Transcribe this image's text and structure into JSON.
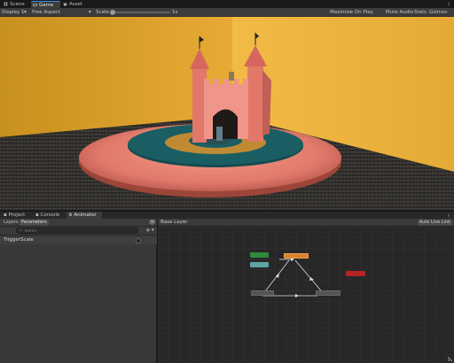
{
  "tabs": [
    {
      "label": "Scene",
      "icon": "grid-icon"
    },
    {
      "label": "Game",
      "icon": "gamepad-icon"
    },
    {
      "label": "Asset Store",
      "icon": "store-icon"
    }
  ],
  "game_toolbar": {
    "display": "Display 1",
    "aspect": "Free Aspect",
    "scale_label": "Scale",
    "scale_value": "1x",
    "maximize": "Maximize On Play",
    "mute": "Mute Audio",
    "stats": "Stats",
    "gizmos": "Gizmos"
  },
  "panel_tabs": [
    {
      "label": "Project",
      "icon": "folder-icon"
    },
    {
      "label": "Console",
      "icon": "console-icon"
    },
    {
      "label": "Animator",
      "icon": "animator-icon"
    }
  ],
  "animator": {
    "sub_tabs": [
      "Layers",
      "Parameters"
    ],
    "search_placeholder": "Name",
    "add_symbol": "+",
    "parameters": [
      {
        "name": "TriggerScale"
      }
    ],
    "layer_name": "Base Layer",
    "auto_live_link": "Auto Live Link"
  },
  "colors": {
    "accent": "#3d8fe8",
    "entry_node": "#2f8a3c",
    "default_state": "#d9822b",
    "exit_node": "#b32424",
    "any_state": "#5fa3a0",
    "state_node": "#545454"
  }
}
